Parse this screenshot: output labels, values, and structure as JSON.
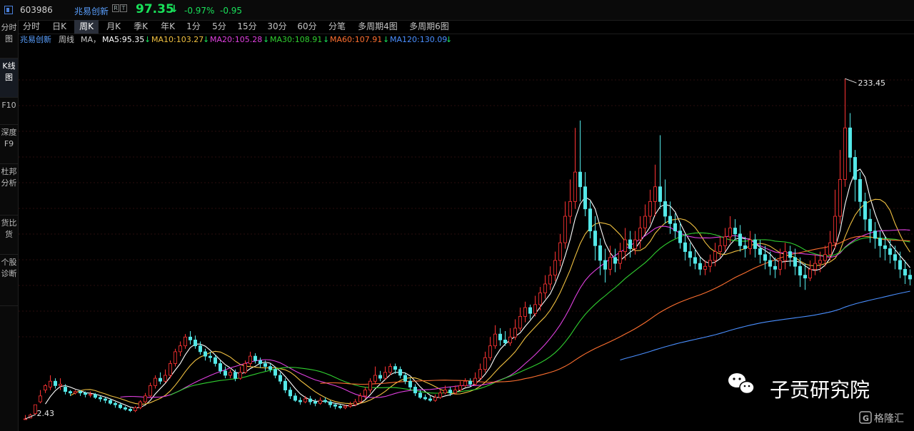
{
  "header": {
    "stock_code": "603986",
    "stock_name": "兆易创新",
    "badge_r": "R",
    "badge_t": "T",
    "price": "97.35",
    "change_pct": "-0.97%",
    "change": "-0.95",
    "down_color": "#19e05a",
    "up_color": "#ff3333"
  },
  "sidebar": {
    "items": [
      {
        "label": "分时图",
        "active": false
      },
      {
        "label": "K线图",
        "active": true
      },
      {
        "label": "F10",
        "active": false
      },
      {
        "label": "深度F9",
        "active": false
      },
      {
        "label": "杜邦分析",
        "active": false
      },
      {
        "label": "货比货",
        "active": false
      },
      {
        "label": "个股诊断",
        "active": false
      }
    ]
  },
  "periods": {
    "tabs": [
      "分时",
      "日K",
      "周K",
      "月K",
      "季K",
      "年K",
      "1分",
      "5分",
      "15分",
      "30分",
      "60分",
      "分笔",
      "多周期4图",
      "多周期6图"
    ],
    "active": "周K"
  },
  "ma_bar": {
    "name": "兆易创新",
    "period": "周线",
    "ma_label": "MA，",
    "items": [
      {
        "text": "MA5:95.35",
        "arrow": "↓",
        "color": "#ffffff"
      },
      {
        "text": "MA10:103.27",
        "arrow": "↓",
        "color": "#f0c040"
      },
      {
        "text": "MA20:105.28",
        "arrow": "↓",
        "color": "#e040e0"
      },
      {
        "text": "MA30:108.91",
        "arrow": "↓",
        "color": "#30d030"
      },
      {
        "text": "MA60:107.91",
        "arrow": "↓",
        "color": "#ff7030"
      },
      {
        "text": "MA120:130.09",
        "arrow": "↓",
        "color": "#4a8fff"
      }
    ]
  },
  "chart_data": {
    "type": "candlestick",
    "title": "",
    "x": [],
    "max_label": "233.45",
    "min_label": "2.43",
    "ylim": [
      0,
      250
    ],
    "candles": [
      [
        2.43,
        2.43,
        5,
        2.43
      ],
      [
        3,
        5,
        6,
        2.8
      ],
      [
        6,
        12,
        12,
        5
      ],
      [
        14,
        18,
        22,
        13
      ],
      [
        22,
        25,
        26,
        20
      ],
      [
        24,
        28,
        32,
        22
      ],
      [
        28,
        25,
        30,
        23
      ],
      [
        25,
        26,
        30,
        22
      ],
      [
        24,
        21,
        26,
        19
      ],
      [
        21,
        20,
        22,
        18
      ],
      [
        20,
        21,
        22,
        19
      ],
      [
        21,
        20,
        22,
        18
      ],
      [
        20,
        19,
        21,
        17
      ],
      [
        19,
        19,
        21,
        17
      ],
      [
        19,
        17,
        20,
        16
      ],
      [
        17,
        16,
        18,
        14
      ],
      [
        16,
        15,
        17,
        13
      ],
      [
        15,
        13,
        16,
        12
      ],
      [
        13,
        12,
        14,
        10
      ],
      [
        12,
        10,
        13,
        9
      ],
      [
        10,
        9,
        11,
        8
      ],
      [
        9,
        8,
        10,
        7
      ],
      [
        8,
        10,
        11,
        7
      ],
      [
        10,
        14,
        15,
        9
      ],
      [
        14,
        18,
        20,
        13
      ],
      [
        18,
        25,
        27,
        17
      ],
      [
        25,
        30,
        32,
        23
      ],
      [
        30,
        28,
        34,
        26
      ],
      [
        28,
        32,
        36,
        27
      ],
      [
        32,
        40,
        42,
        30
      ],
      [
        40,
        48,
        50,
        38
      ],
      [
        48,
        52,
        55,
        45
      ],
      [
        52,
        58,
        60,
        50
      ],
      [
        58,
        56,
        62,
        53
      ],
      [
        56,
        52,
        59,
        50
      ],
      [
        52,
        48,
        55,
        46
      ],
      [
        48,
        45,
        50,
        42
      ],
      [
        45,
        44,
        48,
        41
      ],
      [
        44,
        40,
        46,
        38
      ],
      [
        40,
        35,
        42,
        33
      ],
      [
        35,
        32,
        38,
        30
      ],
      [
        32,
        34,
        36,
        30
      ],
      [
        34,
        30,
        36,
        28
      ],
      [
        30,
        34,
        38,
        29
      ],
      [
        34,
        40,
        42,
        33
      ],
      [
        40,
        45,
        48,
        38
      ],
      [
        45,
        42,
        47,
        40
      ],
      [
        42,
        40,
        44,
        37
      ],
      [
        40,
        38,
        42,
        35
      ],
      [
        38,
        36,
        40,
        34
      ],
      [
        36,
        32,
        38,
        30
      ],
      [
        32,
        28,
        34,
        26
      ],
      [
        28,
        22,
        30,
        20
      ],
      [
        22,
        18,
        24,
        16
      ],
      [
        18,
        15,
        20,
        14
      ],
      [
        15,
        14,
        17,
        12
      ],
      [
        14,
        16,
        18,
        13
      ],
      [
        16,
        14,
        18,
        12
      ],
      [
        14,
        13,
        16,
        11
      ],
      [
        13,
        15,
        17,
        12
      ],
      [
        15,
        14,
        17,
        13
      ],
      [
        14,
        12,
        15,
        10
      ],
      [
        12,
        11,
        13,
        9
      ],
      [
        11,
        10,
        12,
        9
      ],
      [
        10,
        11,
        12,
        9
      ],
      [
        11,
        12,
        14,
        10
      ],
      [
        12,
        14,
        16,
        11
      ],
      [
        14,
        18,
        20,
        13
      ],
      [
        18,
        22,
        24,
        16
      ],
      [
        22,
        28,
        30,
        20
      ],
      [
        28,
        32,
        38,
        26
      ],
      [
        32,
        30,
        35,
        28
      ],
      [
        30,
        34,
        38,
        29
      ],
      [
        34,
        38,
        40,
        32
      ],
      [
        38,
        36,
        40,
        33
      ],
      [
        36,
        32,
        38,
        30
      ],
      [
        32,
        28,
        34,
        26
      ],
      [
        28,
        24,
        30,
        22
      ],
      [
        24,
        20,
        26,
        18
      ],
      [
        20,
        17,
        22,
        16
      ],
      [
        17,
        16,
        19,
        15
      ],
      [
        16,
        15,
        18,
        14
      ],
      [
        15,
        17,
        19,
        14
      ],
      [
        17,
        20,
        22,
        16
      ],
      [
        20,
        22,
        25,
        19
      ],
      [
        22,
        20,
        24,
        18
      ],
      [
        20,
        22,
        25,
        19
      ],
      [
        22,
        25,
        28,
        21
      ],
      [
        25,
        28,
        30,
        24
      ],
      [
        28,
        26,
        30,
        24
      ],
      [
        26,
        30,
        34,
        25
      ],
      [
        30,
        36,
        40,
        29
      ],
      [
        36,
        44,
        48,
        34
      ],
      [
        44,
        52,
        58,
        42
      ],
      [
        52,
        60,
        66,
        50
      ],
      [
        60,
        56,
        64,
        52
      ],
      [
        56,
        54,
        62,
        52
      ],
      [
        54,
        58,
        64,
        52
      ],
      [
        58,
        64,
        70,
        56
      ],
      [
        64,
        72,
        78,
        62
      ],
      [
        72,
        78,
        82,
        68
      ],
      [
        78,
        74,
        80,
        70
      ],
      [
        74,
        80,
        86,
        72
      ],
      [
        80,
        88,
        92,
        76
      ],
      [
        88,
        94,
        100,
        84
      ],
      [
        94,
        100,
        106,
        90
      ],
      [
        100,
        110,
        116,
        96
      ],
      [
        110,
        122,
        128,
        106
      ],
      [
        122,
        140,
        150,
        118
      ],
      [
        140,
        150,
        165,
        135
      ],
      [
        150,
        170,
        200,
        145
      ],
      [
        170,
        160,
        205,
        150
      ],
      [
        160,
        145,
        170,
        140
      ],
      [
        145,
        130,
        150,
        125
      ],
      [
        130,
        120,
        140,
        110
      ],
      [
        120,
        110,
        125,
        100
      ],
      [
        110,
        104,
        118,
        95
      ],
      [
        104,
        112,
        120,
        100
      ],
      [
        112,
        108,
        118,
        102
      ],
      [
        108,
        116,
        122,
        104
      ],
      [
        116,
        124,
        132,
        110
      ],
      [
        124,
        118,
        130,
        112
      ],
      [
        118,
        124,
        130,
        114
      ],
      [
        124,
        132,
        140,
        118
      ],
      [
        132,
        140,
        148,
        128
      ],
      [
        140,
        150,
        158,
        135
      ],
      [
        150,
        160,
        175,
        140
      ],
      [
        160,
        150,
        195,
        145
      ],
      [
        150,
        140,
        165,
        135
      ],
      [
        140,
        135,
        150,
        128
      ],
      [
        135,
        130,
        142,
        125
      ],
      [
        130,
        122,
        136,
        118
      ],
      [
        122,
        116,
        128,
        110
      ],
      [
        116,
        112,
        122,
        106
      ],
      [
        112,
        108,
        118,
        104
      ],
      [
        108,
        104,
        112,
        100
      ],
      [
        104,
        106,
        110,
        100
      ],
      [
        106,
        110,
        114,
        102
      ],
      [
        110,
        116,
        122,
        106
      ],
      [
        116,
        120,
        126,
        112
      ],
      [
        120,
        126,
        132,
        116
      ],
      [
        126,
        132,
        140,
        122
      ],
      [
        132,
        128,
        138,
        124
      ],
      [
        128,
        120,
        134,
        116
      ],
      [
        120,
        118,
        126,
        112
      ],
      [
        118,
        124,
        130,
        114
      ],
      [
        124,
        118,
        128,
        112
      ],
      [
        118,
        114,
        124,
        108
      ],
      [
        114,
        110,
        120,
        104
      ],
      [
        110,
        106,
        116,
        100
      ],
      [
        106,
        104,
        112,
        98
      ],
      [
        104,
        110,
        118,
        100
      ],
      [
        110,
        116,
        122,
        104
      ],
      [
        116,
        112,
        120,
        106
      ],
      [
        112,
        106,
        118,
        100
      ],
      [
        106,
        100,
        112,
        92
      ],
      [
        100,
        98,
        108,
        90
      ],
      [
        98,
        104,
        110,
        96
      ],
      [
        104,
        108,
        114,
        100
      ],
      [
        108,
        110,
        116,
        102
      ],
      [
        110,
        114,
        120,
        106
      ],
      [
        114,
        122,
        130,
        110
      ],
      [
        122,
        140,
        158,
        118
      ],
      [
        140,
        165,
        185,
        135
      ],
      [
        165,
        200,
        233.45,
        160
      ],
      [
        200,
        180,
        210,
        170
      ],
      [
        180,
        165,
        185,
        150
      ],
      [
        165,
        150,
        170,
        140
      ],
      [
        150,
        138,
        156,
        130
      ],
      [
        138,
        130,
        145,
        122
      ],
      [
        130,
        125,
        136,
        118
      ],
      [
        125,
        120,
        130,
        112
      ],
      [
        120,
        118,
        126,
        110
      ],
      [
        118,
        114,
        124,
        108
      ],
      [
        114,
        110,
        120,
        104
      ],
      [
        110,
        104,
        116,
        98
      ],
      [
        104,
        100,
        110,
        94
      ],
      [
        100,
        97.35,
        104,
        93
      ]
    ],
    "series": [
      {
        "name": "MA5",
        "color": "#ffffff"
      },
      {
        "name": "MA10",
        "color": "#f0c040"
      },
      {
        "name": "MA20",
        "color": "#e040e0"
      },
      {
        "name": "MA30",
        "color": "#30d030"
      },
      {
        "name": "MA60",
        "color": "#ff7030"
      },
      {
        "name": "MA120",
        "color": "#4a8fff"
      }
    ]
  },
  "watermark": {
    "text": "子贡研究院",
    "brand": "格隆汇"
  }
}
